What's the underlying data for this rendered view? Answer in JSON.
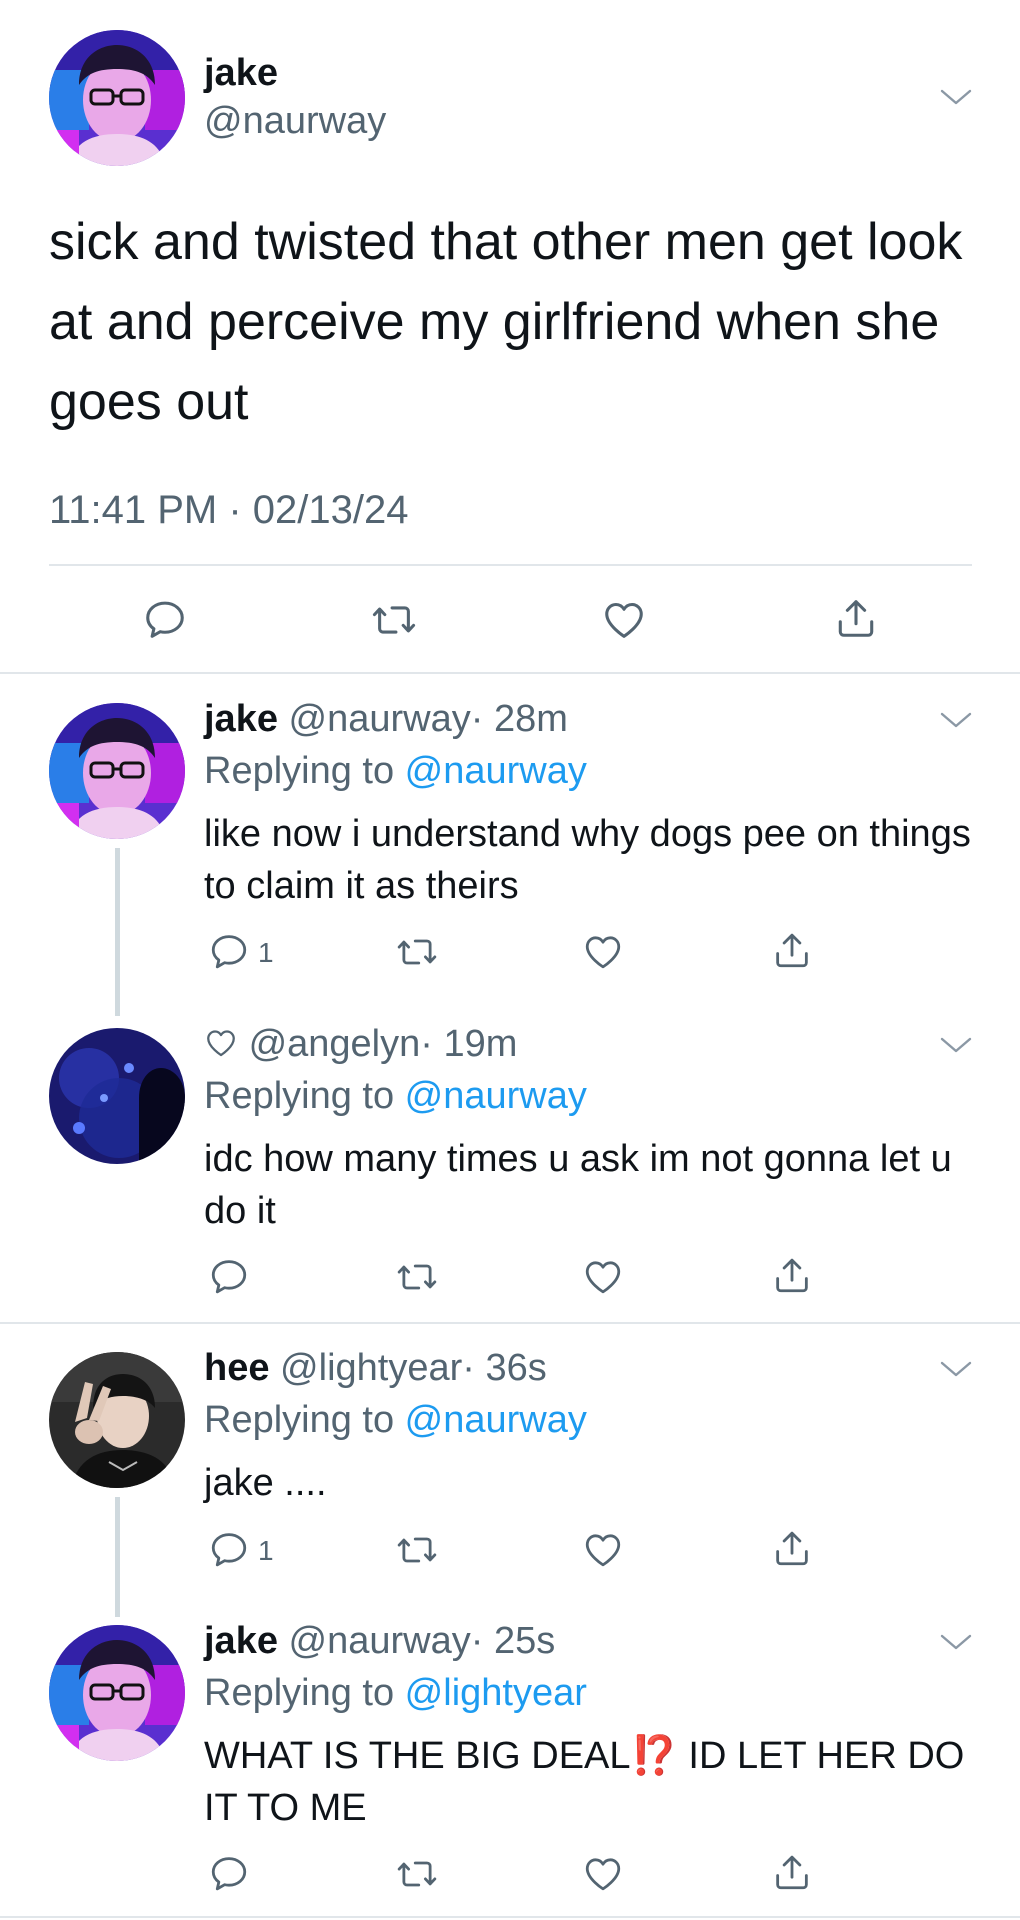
{
  "main_tweet": {
    "name": "jake",
    "handle": "@naurway",
    "text": "sick and twisted that other men get look at and perceive my girlfriend when she goes out",
    "timestamp": "11:41 PM · 02/13/24",
    "actions": [
      "reply-icon",
      "retweet-icon",
      "like-icon",
      "share-icon"
    ]
  },
  "replies": [
    {
      "name": "jake",
      "handle": "@naurway",
      "time": "· 28m",
      "replying_prefix": "Replying to ",
      "replying_to": "@naurway",
      "text": "like now i understand why dogs pee on things to claim it as theirs",
      "reply_count": "1"
    },
    {
      "name": "",
      "handle": "@angelyn",
      "time": "· 19m",
      "replying_prefix": "Replying to ",
      "replying_to": "@naurway",
      "text": "idc how many times u ask im not gonna let u do it",
      "reply_count": ""
    },
    {
      "name": "hee",
      "handle": "@lightyear",
      "time": "· 36s",
      "replying_prefix": "Replying to ",
      "replying_to": "@naurway",
      "text": "jake ....",
      "reply_count": "1"
    },
    {
      "name": "jake",
      "handle": "@naurway",
      "time": "· 25s",
      "replying_prefix": "Replying to ",
      "replying_to": "@lightyear",
      "text_before": "WHAT IS THE BIG DEAL",
      "text_emoji": "⁉️",
      "text_after": " ID LET HER DO IT TO ME",
      "reply_count": ""
    }
  ],
  "colors": {
    "text": "#0f1419",
    "secondary": "#536471",
    "link": "#1d9bf0",
    "divider": "#e1e6ea",
    "thread_line": "#cfd9de"
  }
}
